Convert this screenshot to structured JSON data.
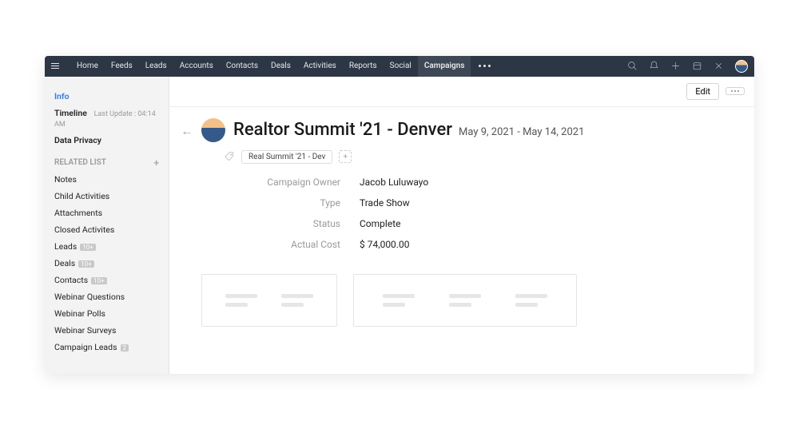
{
  "nav": {
    "items": [
      "Home",
      "Feeds",
      "Leads",
      "Accounts",
      "Contacts",
      "Deals",
      "Activities",
      "Reports",
      "Social",
      "Campaigns"
    ],
    "activeIndex": 9
  },
  "sidebar": {
    "info": "Info",
    "timeline": "Timeline",
    "timeline_sub": "Last Update : 04:14 AM",
    "data_privacy": "Data Privacy",
    "related_header": "RELATED LIST",
    "related": [
      {
        "label": "Notes"
      },
      {
        "label": "Child Activities"
      },
      {
        "label": "Attachments"
      },
      {
        "label": "Closed Activites"
      },
      {
        "label": "Leads",
        "count": "10+"
      },
      {
        "label": "Deals",
        "count": "10+"
      },
      {
        "label": "Contacts",
        "count": "10+"
      },
      {
        "label": "Webinar Questions"
      },
      {
        "label": "Webinar Polls"
      },
      {
        "label": "Webinar Surveys"
      },
      {
        "label": "Campaign Leads",
        "count": "2"
      }
    ]
  },
  "toolbar": {
    "edit": "Edit"
  },
  "record": {
    "title": "Realtor Summit '21 - Denver",
    "date_range": "May 9, 2021 - May 14, 2021",
    "tag": "Real Summit '21 - Dev",
    "fields": {
      "owner_label": "Campaign Owner",
      "owner_value": "Jacob Luluwayo",
      "type_label": "Type",
      "type_value": "Trade Show",
      "status_label": "Status",
      "status_value": "Complete",
      "cost_label": "Actual Cost",
      "cost_value": "$ 74,000.00"
    }
  }
}
